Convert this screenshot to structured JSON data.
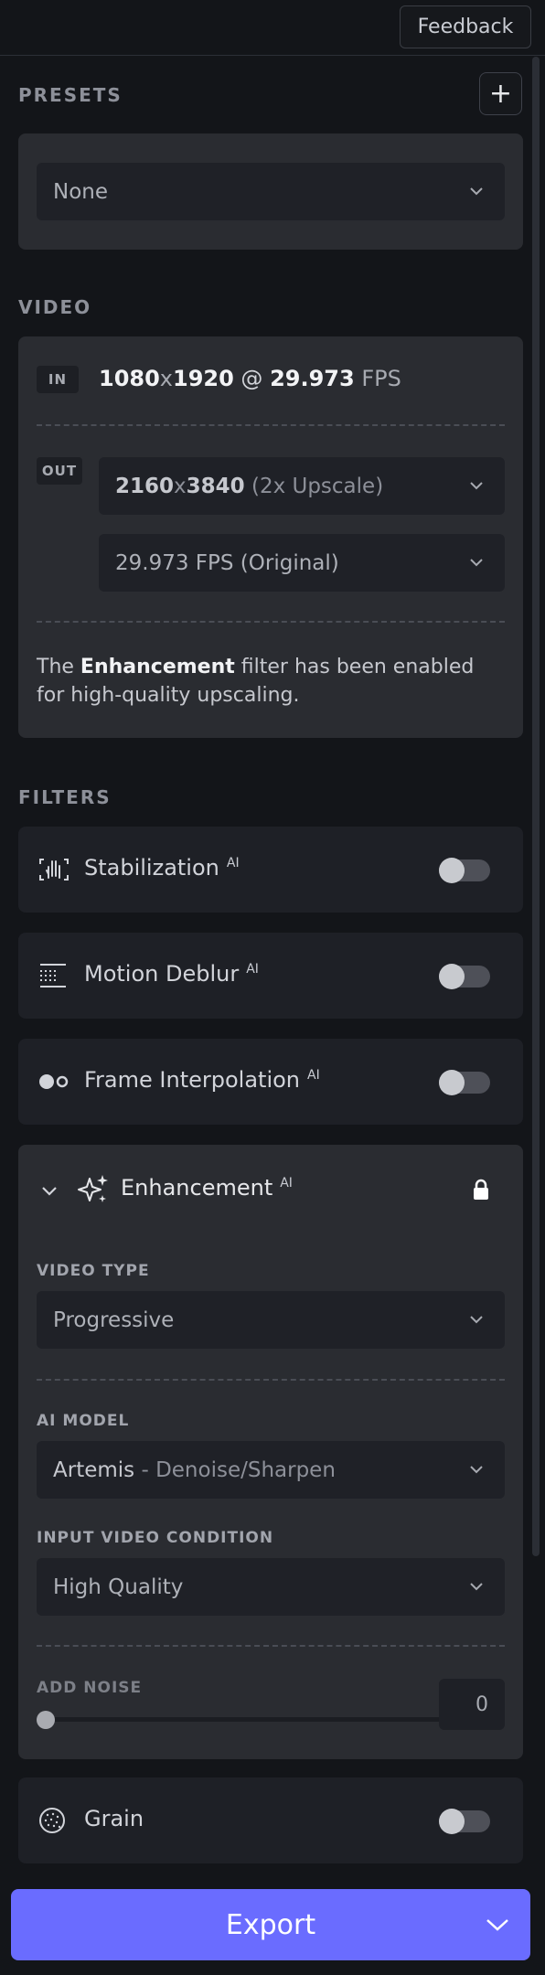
{
  "header": {
    "feedback_label": "Feedback"
  },
  "presets": {
    "section_label": "PRESETS",
    "add_symbol": "+",
    "selected": "None"
  },
  "video": {
    "section_label": "VIDEO",
    "in_tag": "IN",
    "in_width": "1080",
    "in_x": "x",
    "in_height": "1920",
    "in_at": " @ ",
    "in_fps": "29.973",
    "in_fps_unit": " FPS",
    "out_tag": "OUT",
    "out_width": "2160",
    "out_x": "x",
    "out_height": "3840",
    "out_scale": " (2x Upscale)",
    "out_fps": "29.973 FPS (Original)",
    "note_prefix": "The ",
    "note_bold": "Enhancement",
    "note_suffix": " filter has been enabled for high-quality upscaling."
  },
  "filters": {
    "section_label": "FILTERS",
    "ai_badge": "AI",
    "items": [
      {
        "label": "Stabilization",
        "enabled": false
      },
      {
        "label": "Motion Deblur",
        "enabled": false
      },
      {
        "label": "Frame Interpolation",
        "enabled": false
      }
    ],
    "enhancement": {
      "label": "Enhancement",
      "video_type_label": "VIDEO TYPE",
      "video_type": "Progressive",
      "ai_model_label": "AI MODEL",
      "ai_model_name": "Artemis",
      "ai_model_sep": " - ",
      "ai_model_desc": "Denoise/Sharpen",
      "condition_label": "INPUT VIDEO CONDITION",
      "condition": "High Quality",
      "noise_label": "ADD NOISE",
      "noise_value": "0",
      "noise_level": 0
    },
    "grain": {
      "label": "Grain",
      "enabled": false
    }
  },
  "footer": {
    "export_label": "Export"
  },
  "colors": {
    "accent": "#6a6cff",
    "background": "#131519"
  }
}
